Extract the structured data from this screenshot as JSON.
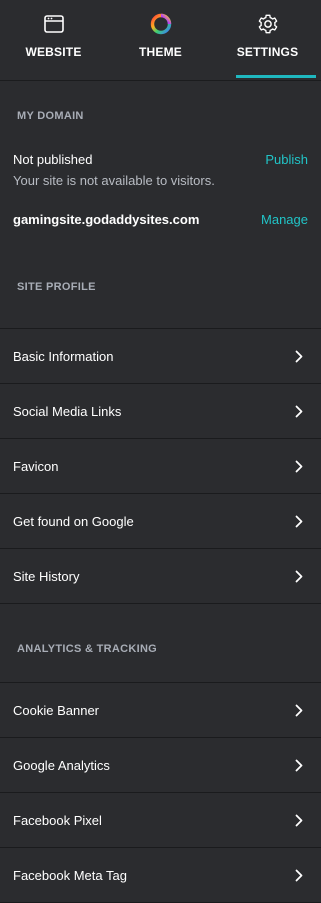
{
  "nav": {
    "tabs": [
      {
        "label": "WEBSITE",
        "icon": "browser-window-icon"
      },
      {
        "label": "THEME",
        "icon": "color-wheel-icon"
      },
      {
        "label": "SETTINGS",
        "icon": "gear-icon"
      }
    ],
    "active": "SETTINGS"
  },
  "domain": {
    "header": "MY DOMAIN",
    "status_title": "Not published",
    "publish_label": "Publish",
    "status_sub": "Your site is not available to visitors.",
    "domain_name": "gamingsite.godaddysites.com",
    "manage_label": "Manage"
  },
  "site_profile": {
    "header": "SITE PROFILE",
    "items": [
      {
        "label": "Basic Information"
      },
      {
        "label": "Social Media Links"
      },
      {
        "label": "Favicon"
      },
      {
        "label": "Get found on Google"
      },
      {
        "label": "Site History"
      }
    ]
  },
  "analytics": {
    "header": "ANALYTICS & TRACKING",
    "items": [
      {
        "label": "Cookie Banner"
      },
      {
        "label": "Google Analytics"
      },
      {
        "label": "Facebook Pixel"
      },
      {
        "label": "Facebook Meta Tag"
      }
    ]
  },
  "colors": {
    "background": "#2b2c2f",
    "accent": "#1fb8c0",
    "link": "#21c4c7",
    "header_text": "#a8adb6",
    "divider": "#1a1b1d"
  }
}
